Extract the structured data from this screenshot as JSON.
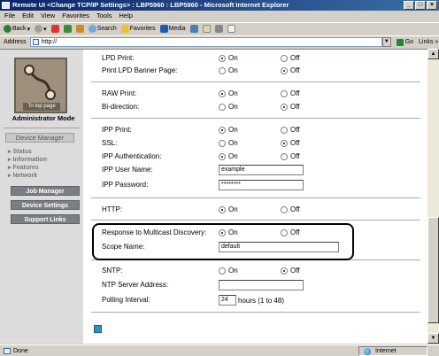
{
  "window": {
    "title": "Remote UI <Change TCP/IP Settings> : LBP5960 : LBP5960 - Microsoft Internet Explorer"
  },
  "menu": [
    "File",
    "Edit",
    "View",
    "Favorites",
    "Tools",
    "Help"
  ],
  "toolbar": {
    "back": "Back",
    "search": "Search",
    "favorites": "Favorites",
    "media": "Media"
  },
  "address": {
    "label": "Address",
    "value": "http://",
    "go": "Go",
    "links": "Links »"
  },
  "sidebar": {
    "to_top": "To top page",
    "mode": "Administrator Mode",
    "device_manager": "Device Manager",
    "nav": [
      "Status",
      "Information",
      "Features",
      "Network"
    ],
    "buttons": [
      "Job Manager",
      "Device Settings",
      "Support Links"
    ]
  },
  "labels": {
    "on": "On",
    "off": "Off"
  },
  "settings": {
    "lpd_print": {
      "label": "LPD Print:",
      "value": "On"
    },
    "lpd_banner": {
      "label": "Print LPD Banner Page:",
      "value": "Off"
    },
    "raw_print": {
      "label": "RAW Print:",
      "value": "On"
    },
    "bi_direction": {
      "label": "Bi-direction:",
      "value": "Off"
    },
    "ipp_print": {
      "label": "IPP Print:",
      "value": "On"
    },
    "ssl": {
      "label": "SSL:",
      "value": "Off"
    },
    "ipp_auth": {
      "label": "IPP Authentication:",
      "value": "On"
    },
    "ipp_user": {
      "label": "IPP User Name:",
      "value": "example"
    },
    "ipp_password": {
      "label": "IPP Password:",
      "value": "********"
    },
    "http": {
      "label": "HTTP:",
      "value": "On"
    },
    "multicast": {
      "label": "Response to Multicast Discovery:",
      "value": "On"
    },
    "scope_name": {
      "label": "Scope Name:",
      "value": "default"
    },
    "sntp": {
      "label": "SNTP:",
      "value": "Off"
    },
    "ntp_server": {
      "label": "NTP Server Address:",
      "value": ""
    },
    "polling": {
      "label": "Polling Interval:",
      "value": "24",
      "hint": "hours (1 to 48)"
    }
  },
  "status": {
    "text": "Done",
    "zone": "Internet"
  }
}
